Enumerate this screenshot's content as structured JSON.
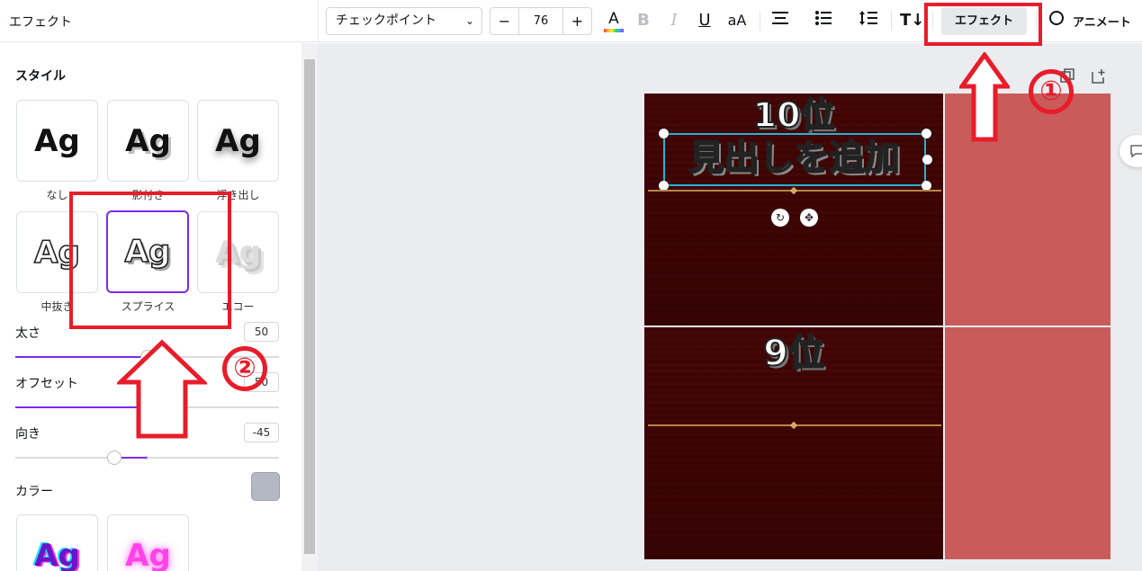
{
  "panel": {
    "title": "エフェクト",
    "section_style": "スタイル",
    "styles": [
      {
        "label": "なし",
        "sample": "Ag"
      },
      {
        "label": "影付き",
        "sample": "Ag"
      },
      {
        "label": "浮き出し",
        "sample": "Ag"
      },
      {
        "label": "中抜き",
        "sample": "Ag"
      },
      {
        "label": "スプライス",
        "sample": "Ag"
      },
      {
        "label": "エコー",
        "sample": "Ag"
      }
    ],
    "selected_style": "スプライス",
    "controls": {
      "thickness": {
        "label": "太さ",
        "value": "50",
        "level": 0.5
      },
      "offset": {
        "label": "オフセット",
        "value": "50",
        "level": 0.5
      },
      "direction": {
        "label": "向き",
        "value": "-45",
        "level": 0.375
      },
      "color": {
        "label": "カラー",
        "value": "#b3b8c2"
      }
    },
    "more_styles": [
      {
        "sample": "Ag"
      },
      {
        "sample": "Ag"
      }
    ]
  },
  "toolbar": {
    "font": "チェックポイント",
    "font_size": "76",
    "minus": "−",
    "plus": "+",
    "effect_button": "エフェクト",
    "animate_button": "アニメート"
  },
  "canvas": {
    "rank_top": "10位",
    "heading": "見出しを追加",
    "rank_bottom": "9位"
  },
  "annotations": {
    "marker_1": "①",
    "marker_2": "②",
    "accent_color": "#e81c2a"
  }
}
